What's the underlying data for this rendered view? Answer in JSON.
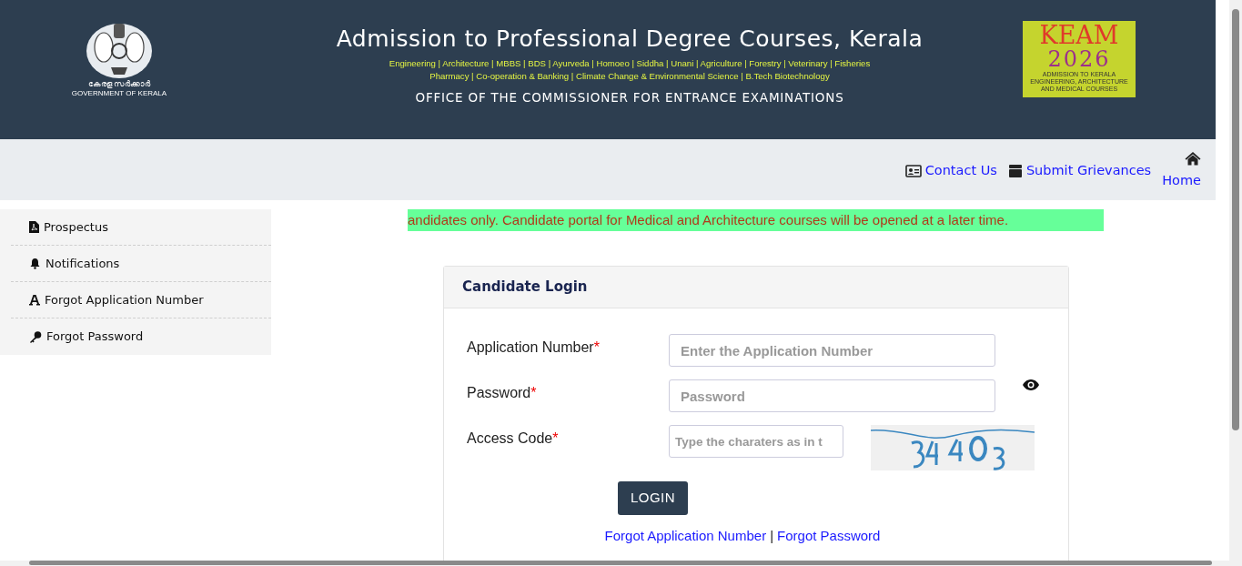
{
  "header": {
    "emblem_caption": "കേരള സർക്കാർ",
    "emblem_subcaption": "GOVERNMENT OF KERALA",
    "title": "Admission to Professional Degree Courses, Kerala",
    "courses": [
      "Engineering | Architecture | MBBS | BDS | Ayurveda | Homoeo | Siddha | Unani | Agriculture | Forestry | Veterinary | Fisheries",
      "Pharmacy | Co-operation & Banking | Climate Change & Environmental Science | B.Tech Biotechnology"
    ],
    "office": "OFFICE OF THE COMMISSIONER FOR ENTRANCE EXAMINATIONS",
    "logo": {
      "word": "KEAM",
      "year": "2026",
      "tagline": "ADMISSION TO KERALA ENGINEERING, ARCHITECTURE AND MEDICAL COURSES"
    }
  },
  "top_links": [
    {
      "kind": "contact",
      "label": "Contact Us"
    },
    {
      "kind": "grievance",
      "label": "Submit Grievances"
    },
    {
      "kind": "home",
      "label": "Home"
    }
  ],
  "sidebar": {
    "items": [
      {
        "kind": "pdf",
        "label": "Prospectus"
      },
      {
        "kind": "bell",
        "label": "Notifications"
      },
      {
        "kind": "font",
        "label": "Forgot Application Number"
      },
      {
        "kind": "key",
        "label": "Forgot Password"
      }
    ]
  },
  "notice": "andidates only. Candidate portal for Medical and Architecture courses will be opened at a later time.",
  "login": {
    "title": "Candidate Login",
    "fields": [
      {
        "kind": "text",
        "label": "Application Number",
        "required_mark": "*",
        "placeholder": "Enter the Application Number"
      },
      {
        "kind": "password",
        "label": "Password",
        "required_mark": "*",
        "placeholder": "Password"
      },
      {
        "kind": "captcha",
        "label": "Access Code",
        "required_mark": "*",
        "placeholder": "Type the charaters as in t"
      }
    ],
    "button": "LOGIN",
    "links": [
      "Forgot Application Number",
      "Forgot Password"
    ],
    "link_separator": "|"
  }
}
